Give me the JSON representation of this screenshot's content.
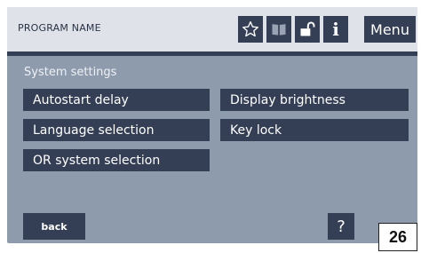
{
  "header": {
    "program_name": "PROGRAM NAME",
    "icons": [
      "star-icon",
      "book-icon",
      "unlock-icon",
      "info-icon"
    ],
    "info_label": "i",
    "menu_label": "Menu"
  },
  "main": {
    "section_title": "System settings",
    "buttons": [
      "Autostart delay",
      "Display brightness",
      "Language selection",
      "Key lock",
      "OR system selection"
    ]
  },
  "footer": {
    "back_label": "back",
    "help_label": "?"
  },
  "page_number": "26",
  "colors": {
    "header_bg": "#dfe2e8",
    "screen_bg": "#8e9bad",
    "button_bg": "#343f55",
    "text_light": "#ffffff"
  }
}
